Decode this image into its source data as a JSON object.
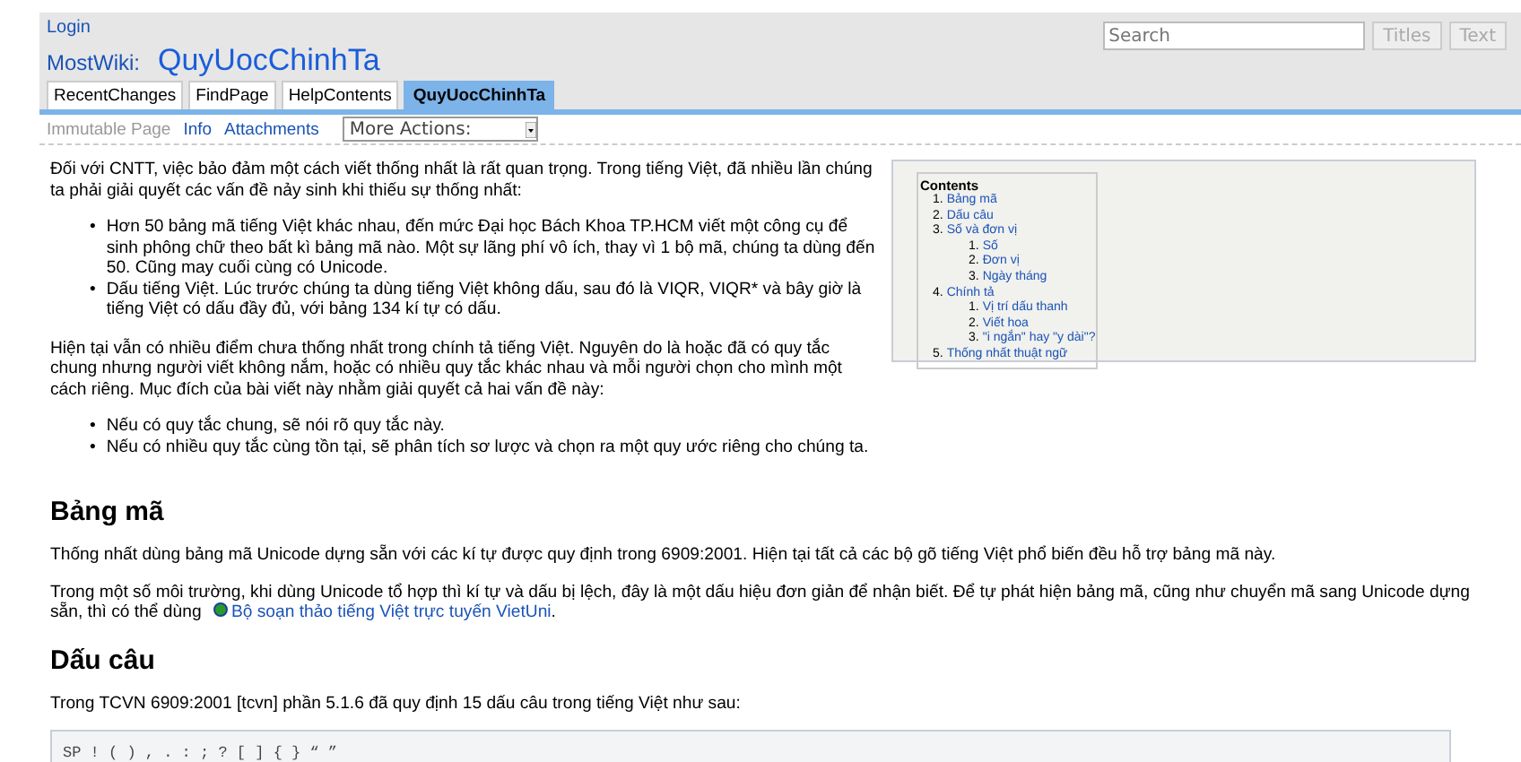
{
  "header": {
    "login": "Login",
    "site": "MostWiki:",
    "page_title": "QuyUocChinhTa",
    "search": {
      "placeholder": "Search"
    },
    "search_buttons": [
      "Titles",
      "Text"
    ]
  },
  "tabs": [
    {
      "label": "RecentChanges",
      "selected": false
    },
    {
      "label": "FindPage",
      "selected": false
    },
    {
      "label": "HelpContents",
      "selected": false
    },
    {
      "label": "QuyUocChinhTa",
      "selected": true
    }
  ],
  "actions": [
    {
      "label": "Immutable Page",
      "disabled": true
    },
    {
      "label": "Info",
      "disabled": false
    },
    {
      "label": "Attachments",
      "disabled": false
    }
  ],
  "more_actions": "More Actions:",
  "toc": {
    "title": "Contents",
    "items": [
      {
        "number": "1.",
        "label": "Bảng mã"
      },
      {
        "number": "2.",
        "label": "Dấu câu"
      },
      {
        "number": "3.",
        "label": "Số và đơn vị",
        "children": [
          {
            "number": "1.",
            "label": "Số"
          },
          {
            "number": "2.",
            "label": "Đơn vị"
          },
          {
            "number": "3.",
            "label": "Ngày tháng"
          }
        ]
      },
      {
        "number": "4.",
        "label": "Chính tả",
        "children": [
          {
            "number": "1.",
            "label": "Vị trí dấu thanh"
          },
          {
            "number": "2.",
            "label": "Viết hoa"
          },
          {
            "number": "3.",
            "label": "\"i ngắn\" hay \"y dài\"?"
          }
        ]
      },
      {
        "number": "5.",
        "label": "Thống nhất thuật ngữ"
      }
    ]
  },
  "content": [
    {
      "kind": "paragraph",
      "text": "Đối với CNTT, việc bảo đảm một cách viết thống nhất là rất quan trọng. Trong tiếng Việt, đã nhiều lần chúng ta phải giải quyết các vấn đề nảy sinh khi thiếu sự thống nhất:"
    },
    {
      "kind": "list",
      "bullet": "•",
      "items": [
        "Hơn 50 bảng mã tiếng Việt khác nhau, đến mức Đại học Bách Khoa TP.HCM viết một công cụ để sinh phông chữ theo bất kì bảng mã nào. Một sự lãng phí vô ích, thay vì 1 bộ mã, chúng ta dùng đến 50. Cũng may cuối cùng có Unicode.",
        "Dấu tiếng Việt. Lúc trước chúng ta dùng tiếng Việt không dấu, sau đó là VIQR, VIQR* và bây giờ là tiếng Việt có dấu đầy đủ, với bảng 134 kí tự có dấu."
      ]
    },
    {
      "kind": "paragraph",
      "text": "Hiện tại vẫn có nhiều điểm chưa thống nhất trong chính tả tiếng Việt. Nguyên do là hoặc đã có quy tắc chung nhưng người viết không nắm, hoặc có nhiều quy tắc khác nhau và mỗi người chọn cho mình một cách riêng. Mục đích của bài viết này nhằm giải quyết cả hai vấn đề này:"
    },
    {
      "kind": "list",
      "bullet": "•",
      "items": [
        "Nếu có quy tắc chung, sẽ nói rõ quy tắc này.",
        "Nếu có nhiều quy tắc cùng tồn tại, sẽ phân tích sơ lược và chọn ra một quy ước riêng cho chúng ta."
      ]
    },
    {
      "kind": "heading",
      "text": "Bảng mã"
    },
    {
      "kind": "paragraph",
      "text": "Thống nhất dùng bảng mã Unicode dựng sẵn với các kí tự được quy định trong 6909:2001. Hiện tại tất cả các bộ gõ tiếng Việt phổ biến đều hỗ trợ bảng mã này."
    },
    {
      "kind": "paragraph",
      "text": "Trong một số môi trường, khi dùng Unicode tổ hợp thì kí tự và dấu bị lệch, đây là một dấu hiệu đơn giản để nhận biết. Để tự phát hiện bảng mã, cũng như chuyển mã sang Unicode dựng sẵn, thì có thể dùng ",
      "link": "Bộ soạn thảo tiếng Việt trực tuyến VietUni",
      "after": "."
    },
    {
      "kind": "heading",
      "text": "Dấu câu"
    },
    {
      "kind": "paragraph",
      "text": "Trong TCVN 6909:2001 [tcvn] phần 5.1.6 đã quy định 15 dấu câu trong tiếng Việt như sau:"
    },
    {
      "kind": "code",
      "text": "SP ! ( ) , . : ; ? [ ] { } “ ”"
    }
  ]
}
